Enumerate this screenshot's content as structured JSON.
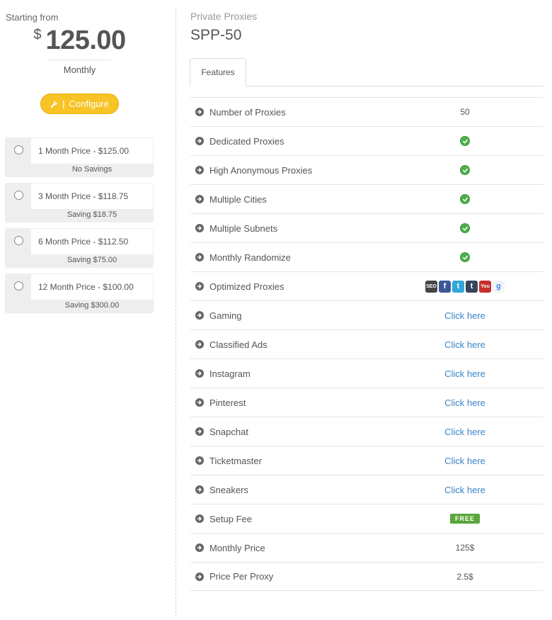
{
  "summary": {
    "starting_label": "Starting from",
    "currency_symbol": "$",
    "amount": "125.00",
    "cycle": "Monthly",
    "configure_label": "Configure",
    "configure_sep": "|"
  },
  "billing_options": [
    {
      "label": "1 Month Price - $125.00",
      "savings": "No Savings"
    },
    {
      "label": "3 Month Price - $118.75",
      "savings": "Saving $18.75"
    },
    {
      "label": "6 Month Price - $112.50",
      "savings": "Saving $75.00"
    },
    {
      "label": "12 Month Price - $100.00",
      "savings": "Saving $300.00"
    }
  ],
  "product": {
    "category": "Private Proxies",
    "name": "SPP-50",
    "tab_label": "Features"
  },
  "features": [
    {
      "label": "Number of Proxies",
      "value": "50"
    },
    {
      "label": "Dedicated Proxies",
      "icon": "check-icon"
    },
    {
      "label": "High Anonymous Proxies",
      "icon": "check-icon"
    },
    {
      "label": "Multiple Cities",
      "icon": "check-icon"
    },
    {
      "label": "Multiple Subnets",
      "icon": "check-icon"
    },
    {
      "label": "Monthly Randomize",
      "icon": "check-icon"
    },
    {
      "label": "Optimized Proxies",
      "icons": [
        "seo-icon",
        "facebook-icon",
        "twitter-icon",
        "tumblr-icon",
        "youtube-icon",
        "google-icon"
      ]
    },
    {
      "label": "Gaming",
      "link": "Click here"
    },
    {
      "label": "Classified Ads",
      "link": "Click here"
    },
    {
      "label": "Instagram",
      "link": "Click here"
    },
    {
      "label": "Pinterest",
      "link": "Click here"
    },
    {
      "label": "Snapchat",
      "link": "Click here"
    },
    {
      "label": "Ticketmaster",
      "link": "Click here"
    },
    {
      "label": "Sneakers",
      "link": "Click here"
    },
    {
      "label": "Setup Fee",
      "badge": "FREE"
    },
    {
      "label": "Monthly Price",
      "value": "125$"
    },
    {
      "label": "Price Per Proxy",
      "value": "2.5$"
    }
  ],
  "social_icons": {
    "seo_text": "SEO",
    "facebook_text": "f",
    "twitter_text": "t",
    "tumblr_text": "t",
    "youtube_text": "You",
    "google_text": "g"
  },
  "colors": {
    "accent_yellow": "#f7c325",
    "link_blue": "#3a85c6",
    "check_green": "#4fae4c",
    "free_green": "#5aa63a"
  }
}
